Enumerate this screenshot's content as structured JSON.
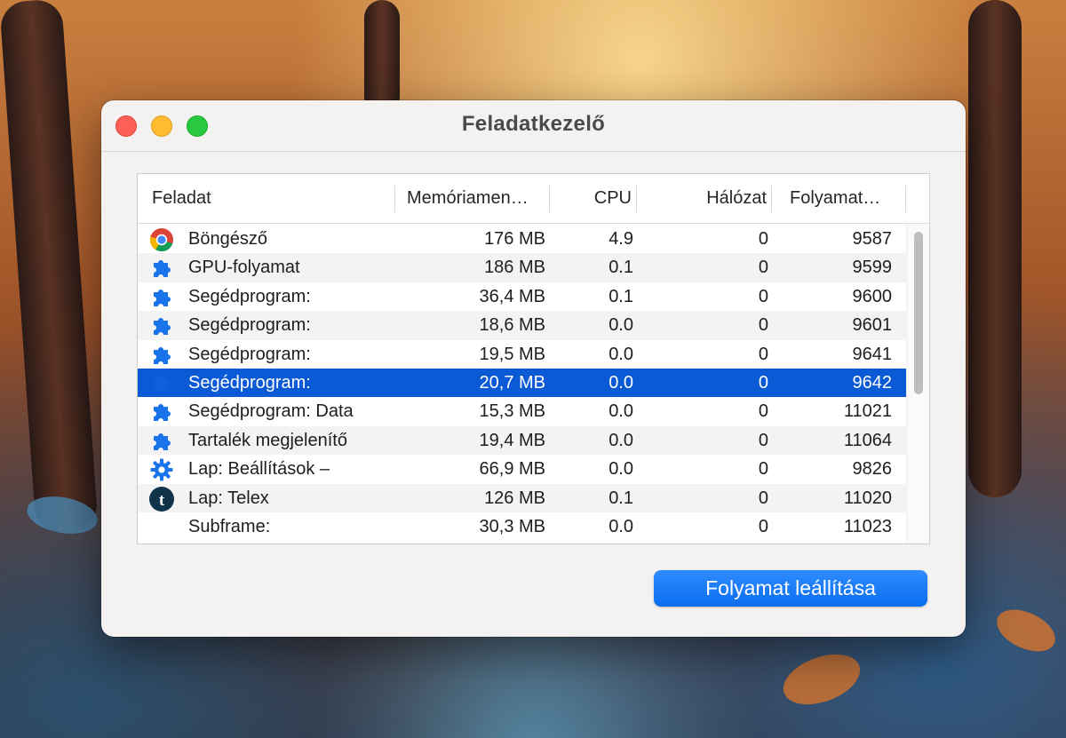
{
  "window": {
    "title": "Feladatkezelő"
  },
  "columns": {
    "task": "Feladat",
    "memory": "Memóriamen…",
    "cpu": "CPU",
    "network": "Hálózat",
    "process": "Folyamat…"
  },
  "rows": [
    {
      "name": "Böngésző",
      "memory": "176 MB",
      "cpu": "4.9",
      "network": "0",
      "pid": "9587",
      "icon": "chrome-icon"
    },
    {
      "name": "GPU-folyamat",
      "memory": "186 MB",
      "cpu": "0.1",
      "network": "0",
      "pid": "9599",
      "icon": "puzzle-icon"
    },
    {
      "name": "Segédprogram:",
      "memory": "36,4 MB",
      "cpu": "0.1",
      "network": "0",
      "pid": "9600",
      "icon": "puzzle-icon"
    },
    {
      "name": "Segédprogram:",
      "memory": "18,6 MB",
      "cpu": "0.0",
      "network": "0",
      "pid": "9601",
      "icon": "puzzle-icon"
    },
    {
      "name": "Segédprogram:",
      "memory": "19,5 MB",
      "cpu": "0.0",
      "network": "0",
      "pid": "9641",
      "icon": "puzzle-icon"
    },
    {
      "name": "Segédprogram:",
      "memory": "20,7 MB",
      "cpu": "0.0",
      "network": "0",
      "pid": "9642",
      "icon": "puzzle-icon",
      "selected": true
    },
    {
      "name": "Segédprogram: Data",
      "memory": "15,3 MB",
      "cpu": "0.0",
      "network": "0",
      "pid": "11021",
      "icon": "puzzle-icon"
    },
    {
      "name": "Tartalék megjelenítő",
      "memory": "19,4 MB",
      "cpu": "0.0",
      "network": "0",
      "pid": "11064",
      "icon": "puzzle-icon"
    },
    {
      "name": "Lap: Beállítások –",
      "memory": "66,9 MB",
      "cpu": "0.0",
      "network": "0",
      "pid": "9826",
      "icon": "gear-icon"
    },
    {
      "name": "Lap: Telex",
      "memory": "126 MB",
      "cpu": "0.1",
      "network": "0",
      "pid": "11020",
      "icon": "telex-icon"
    },
    {
      "name": "Subframe:",
      "memory": "30,3 MB",
      "cpu": "0.0",
      "network": "0",
      "pid": "11023",
      "icon": ""
    }
  ],
  "actions": {
    "end_process": "Folyamat leállítása"
  },
  "colors": {
    "selection": "#0a5ad6",
    "button": "#0a6ef0",
    "icon_blue": "#1a73e8"
  }
}
